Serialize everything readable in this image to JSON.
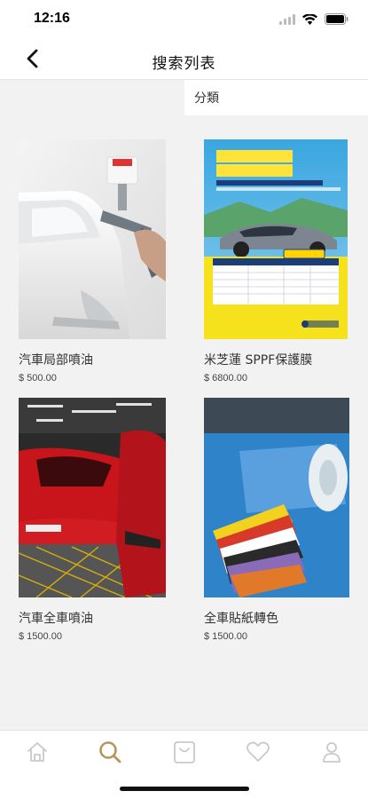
{
  "status": {
    "time": "12:16"
  },
  "header": {
    "title": "搜索列表"
  },
  "filter": {
    "label": "分類"
  },
  "products": [
    {
      "name": "汽車局部噴油",
      "price": "$ 500.00"
    },
    {
      "name": "米芝蓮 SPPF保護膜",
      "price": "$ 6800.00"
    },
    {
      "name": "汽車全車噴油",
      "price": "$ 1500.00"
    },
    {
      "name": "全車貼紙轉色",
      "price": "$ 1500.00"
    }
  ],
  "tabs": [
    {
      "icon": "home-icon",
      "active": false
    },
    {
      "icon": "search-icon",
      "active": true
    },
    {
      "icon": "cart-icon",
      "active": false
    },
    {
      "icon": "heart-icon",
      "active": false
    },
    {
      "icon": "user-icon",
      "active": false
    }
  ],
  "colors": {
    "accent": "#b8955a",
    "inactive": "#c9c9c9"
  }
}
